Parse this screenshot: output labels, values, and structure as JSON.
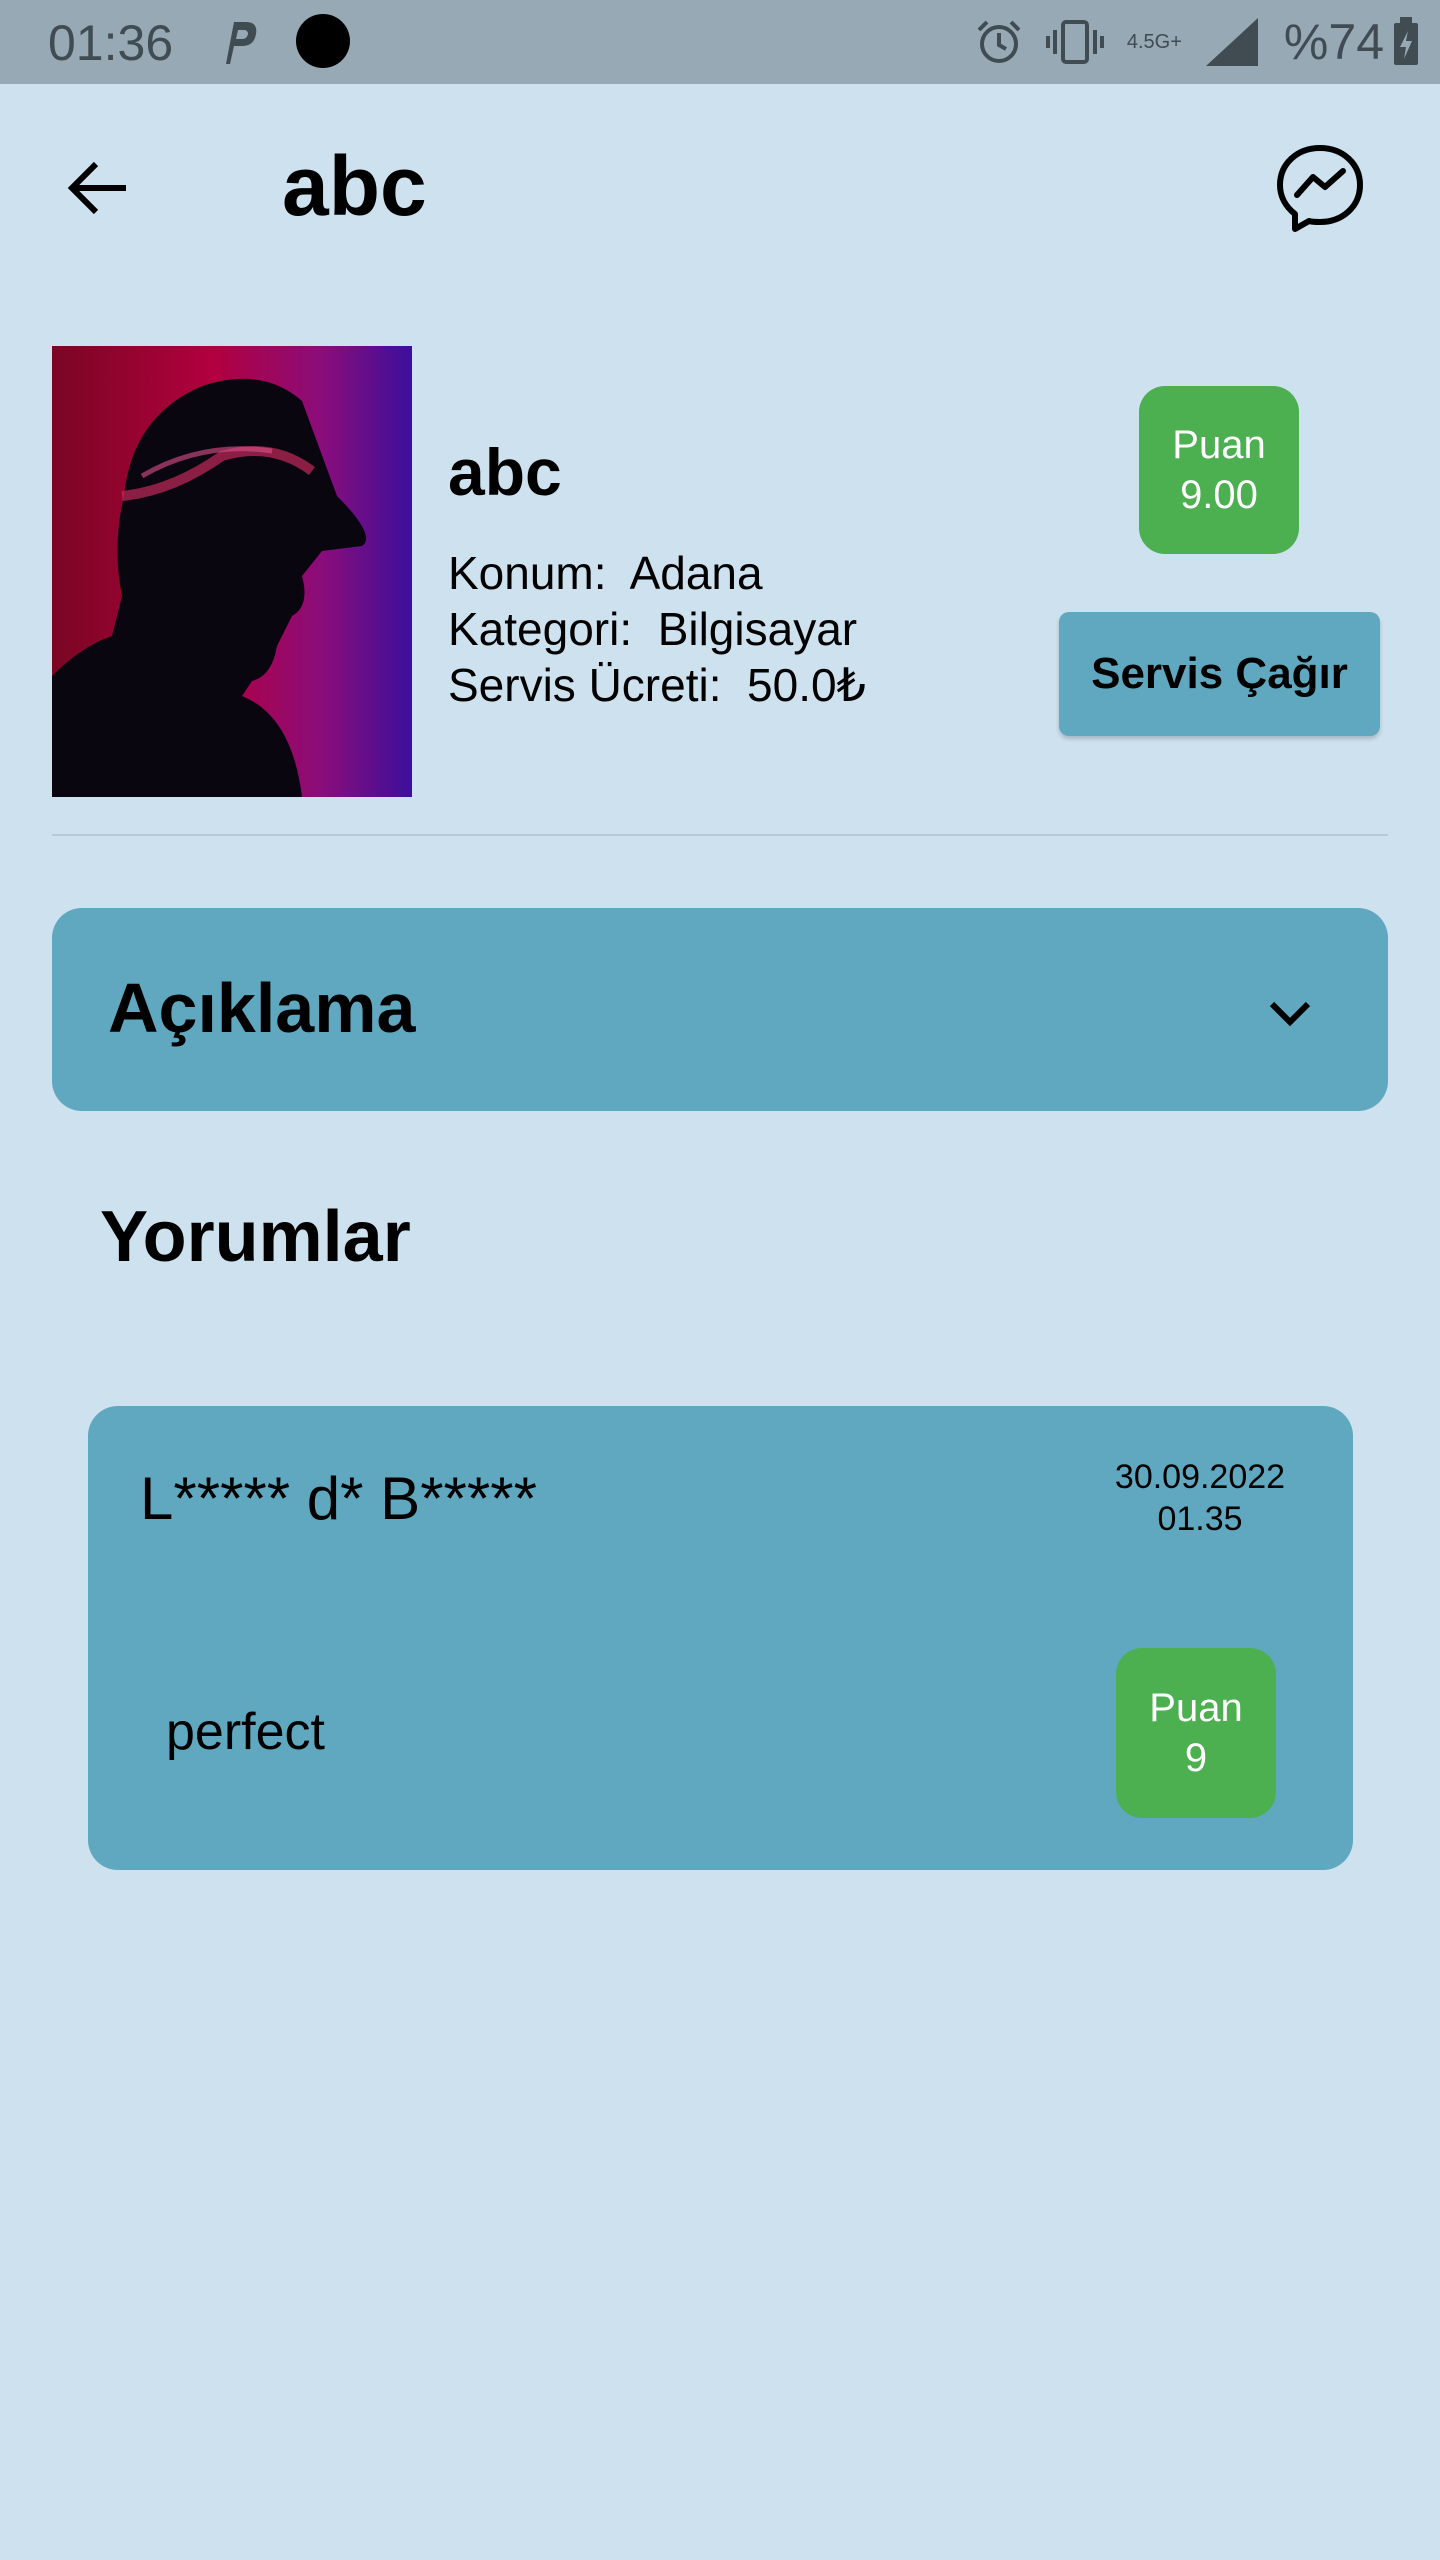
{
  "status_bar": {
    "time": "01:36",
    "network": "4.5G+",
    "battery": "%74",
    "icons": [
      "parking-icon",
      "notification-dot-icon",
      "alarm-icon",
      "vibrate-icon",
      "signal-icon",
      "battery-charging-icon"
    ]
  },
  "app_bar": {
    "title": "abc",
    "back_icon": "back-arrow-icon",
    "action_icon": "messenger-icon"
  },
  "provider": {
    "name": "abc",
    "location_label": "Konum:",
    "location_value": "Adana",
    "category_label": "Kategori:",
    "category_value": "Bilgisayar",
    "fee_label": "Servis Ücreti:",
    "fee_value": "50.0₺",
    "score_label": "Puan",
    "score_value": "9.00",
    "call_button": "Servis Çağır"
  },
  "description": {
    "title": "Açıklama",
    "icon": "chevron-down-icon"
  },
  "reviews": {
    "title": "Yorumlar",
    "items": [
      {
        "author": "L***** d* B*****",
        "date": "30.09.2022",
        "time": "01.35",
        "text": "perfect",
        "score_label": "Puan",
        "score_value": "9"
      }
    ]
  },
  "colors": {
    "background": "#cde1ef",
    "status_bar": "#97a9b5",
    "card": "#5fa8bf",
    "score_badge": "#4caf50"
  }
}
